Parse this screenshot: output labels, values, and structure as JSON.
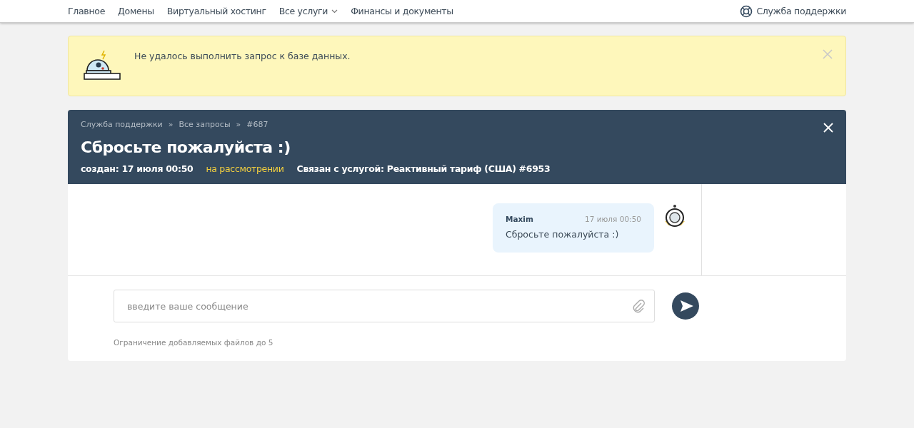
{
  "nav": {
    "items": [
      {
        "label": "Главное",
        "has_menu": false
      },
      {
        "label": "Домены",
        "has_menu": false
      },
      {
        "label": "Виртуальный хостинг",
        "has_menu": false
      },
      {
        "label": "Все услуги",
        "has_menu": true
      },
      {
        "label": "Финансы и документы",
        "has_menu": false
      }
    ],
    "support": "Служба поддержки"
  },
  "alert": {
    "message": "Не удалось выполнить запрос к базе данных."
  },
  "ticket": {
    "breadcrumbs": [
      "Служба поддержки",
      "Все запросы",
      "#687"
    ],
    "separator": "»",
    "title": "Сбросьте пожалуйста :)",
    "created": "создан: 17 июля 00:50",
    "status": "на рассмотрении",
    "service": "Связан с услугой: Реактивный тариф (США) #6953"
  },
  "messages": [
    {
      "author": "Maxim",
      "time": "17 июля 00:50",
      "text": "Сбросьте пожалуйста :)"
    }
  ],
  "composer": {
    "placeholder": "введите ваше сообщение",
    "note": "Ограничение добавляемых файлов до 5"
  }
}
